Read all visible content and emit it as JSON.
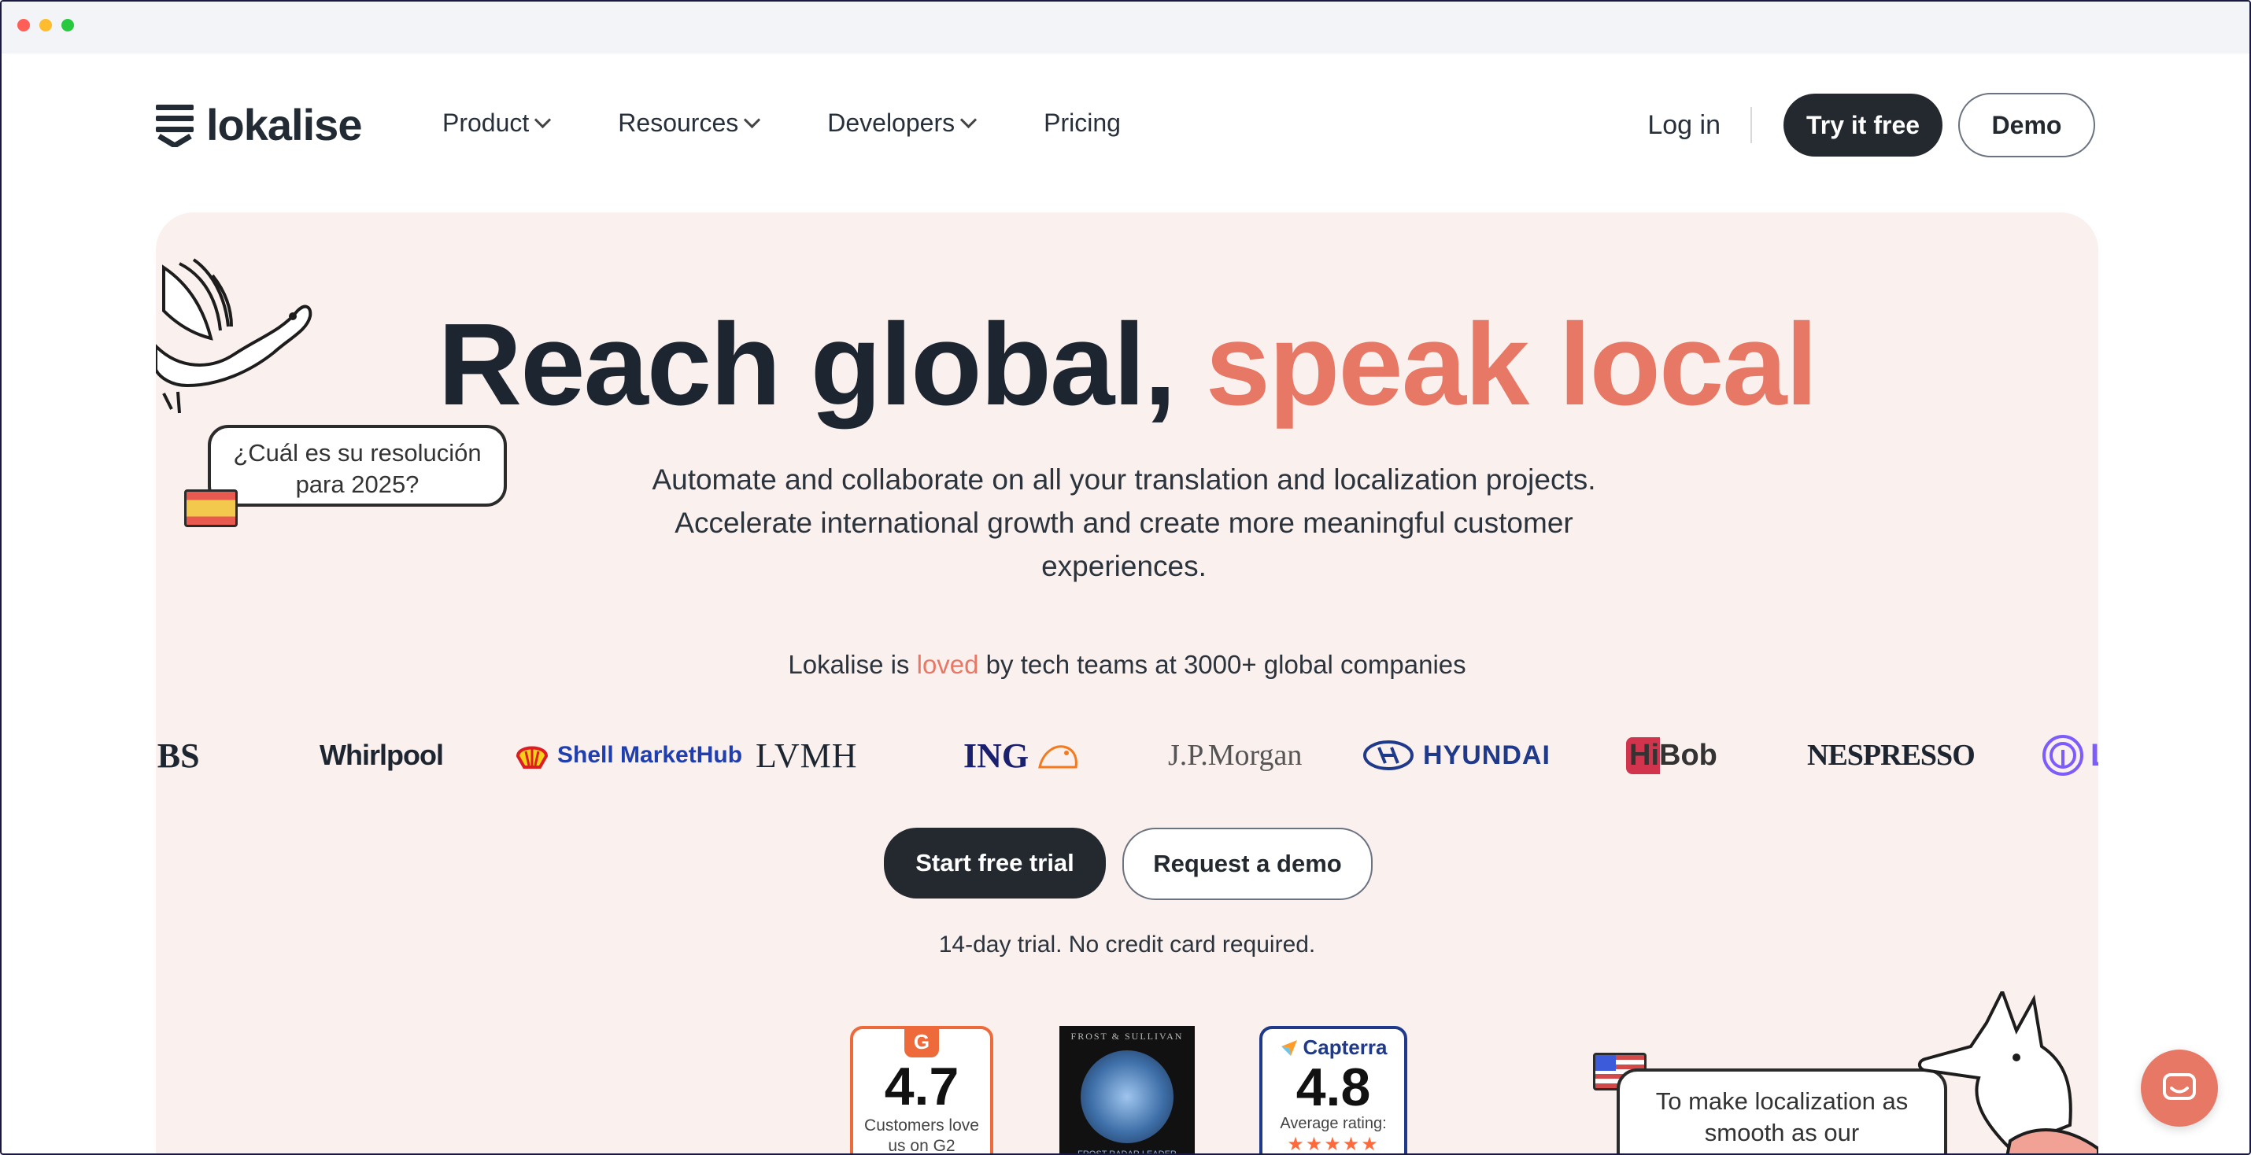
{
  "nav": {
    "logo_text": "lokalise",
    "links": [
      {
        "label": "Product"
      },
      {
        "label": "Resources"
      },
      {
        "label": "Developers"
      },
      {
        "label": "Pricing"
      }
    ],
    "login": "Log in",
    "try_free": "Try it free",
    "demo": "Demo"
  },
  "hero": {
    "headline_main": "Reach global, ",
    "headline_accent": "speak local",
    "subtext": "Automate and collaborate on all your translation and localization projects. Accelerate international growth and create more meaningful customer experiences.",
    "loved_prefix": "Lokalise is ",
    "loved_word": "loved",
    "loved_suffix": " by tech teams at 3000+ global companies",
    "bubble_left": "¿Cuál es su resolución para 2025?",
    "bubble_right": "To make localization as smooth as our"
  },
  "logos": [
    "DBS",
    "Whirlpool",
    "Shell MarketHub",
    "LVMH",
    "ING",
    "J.P.Morgan",
    "HYUNDAI",
    "HiBob",
    "NESPRESSO",
    "L"
  ],
  "cta": {
    "start": "Start free trial",
    "request": "Request a demo",
    "trial_note": "14-day trial. No credit card required."
  },
  "badges": {
    "g2": {
      "score": "4.7",
      "caption": "Customers love us on G2"
    },
    "frost": {
      "top": "FROST & SULLIVAN",
      "bottom": "FROST RADAR LEADER"
    },
    "capterra": {
      "name": "Capterra",
      "score": "4.8",
      "caption": "Average rating:"
    }
  },
  "colors": {
    "accent": "#e87866",
    "dark": "#23292f",
    "hero_bg": "#faf0ee"
  }
}
